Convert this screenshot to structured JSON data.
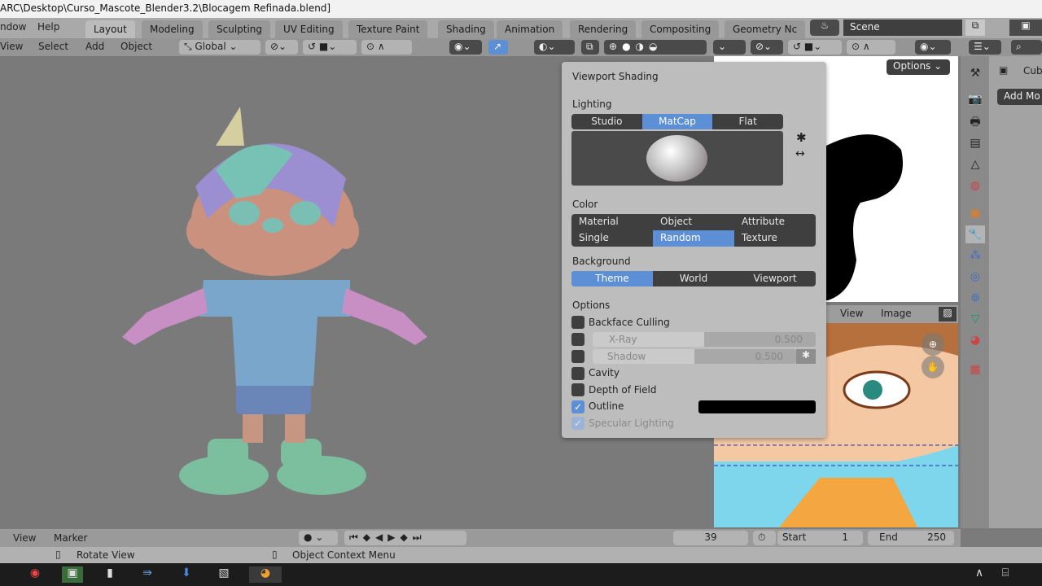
{
  "window": {
    "title": "ARC\\Desktop\\Curso_Mascote_Blender3.2\\Blocagem Refinada.blend]"
  },
  "menu": [
    "ndow",
    "Help"
  ],
  "workspaces": [
    {
      "label": "Layout",
      "active": true
    },
    {
      "label": "Modeling"
    },
    {
      "label": "Sculpting"
    },
    {
      "label": "UV Editing"
    },
    {
      "label": "Texture Paint"
    },
    {
      "label": "Shading"
    },
    {
      "label": "Animation"
    },
    {
      "label": "Rendering"
    },
    {
      "label": "Compositing"
    },
    {
      "label": "Geometry Nc"
    }
  ],
  "scene": {
    "name": "Scene"
  },
  "viewport_header": {
    "menus": [
      "View",
      "Select",
      "Add",
      "Object"
    ],
    "orientation": "Global"
  },
  "shading_popup": {
    "title": "Viewport Shading",
    "lighting_label": "Lighting",
    "lighting": [
      "Studio",
      "MatCap",
      "Flat"
    ],
    "lighting_selected": "MatCap",
    "color_label": "Color",
    "color": [
      "Material",
      "Object",
      "Attribute",
      "Single",
      "Random",
      "Texture"
    ],
    "color_selected": "Random",
    "background_label": "Background",
    "background": [
      "Theme",
      "World",
      "Viewport"
    ],
    "background_selected": "Theme",
    "options_label": "Options",
    "options": {
      "backface": "Backface Culling",
      "xray": "X-Ray",
      "xray_value": "0.500",
      "shadow": "Shadow",
      "shadow_value": "0.500",
      "cavity": "Cavity",
      "dof": "Depth of Field",
      "outline": "Outline",
      "specular": "Specular Lighting"
    },
    "checked": {
      "backface": false,
      "xray": false,
      "shadow": false,
      "cavity": false,
      "dof": false,
      "outline": true,
      "specular": true
    },
    "outline_color": "#000000",
    "accent": "#5d8fd6"
  },
  "image_editor": {
    "options": "Options",
    "menus": [
      "View",
      "Image"
    ]
  },
  "properties": {
    "object": "Cub",
    "add_modifier": "Add Mo"
  },
  "timeline": {
    "menus": [
      "View",
      "Marker"
    ],
    "current_frame": "39",
    "start_label": "Start",
    "start": "1",
    "end_label": "End",
    "end": "250"
  },
  "status": {
    "left": "Rotate View",
    "middle": "Object Context Menu"
  }
}
